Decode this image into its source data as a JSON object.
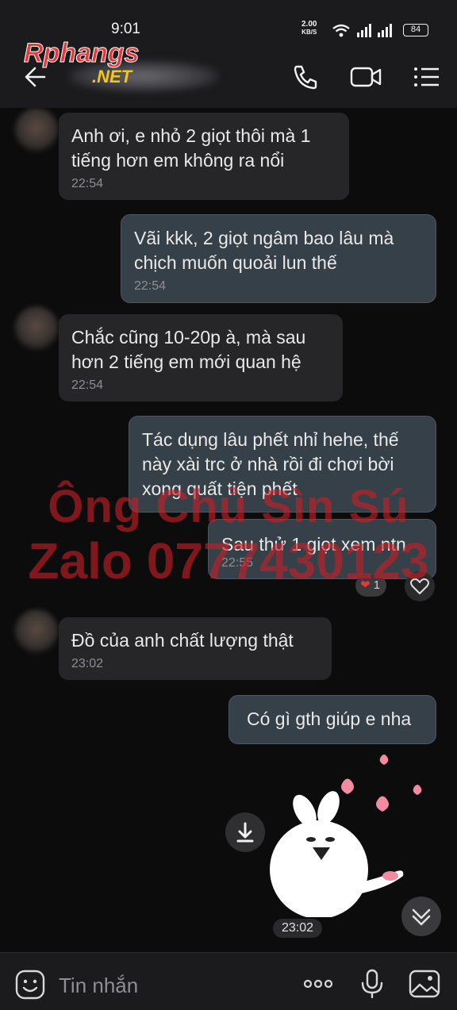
{
  "status_bar": {
    "time": "9:01",
    "speed_value": "2.00",
    "speed_unit": "KB/S",
    "battery": "84"
  },
  "header": {
    "logo_main": "Rphangs",
    "logo_sub": ".NET"
  },
  "messages": [
    {
      "direction": "in",
      "text": "Anh ơi, e nhỏ 2 giọt thôi mà 1 tiếng hơn em không ra nổi",
      "time": "22:54"
    },
    {
      "direction": "out",
      "text": "Vãi kkk, 2 giọt ngâm bao lâu mà chịch muốn quoải lun thế",
      "time": "22:54"
    },
    {
      "direction": "in",
      "text": "Chắc cũng 10-20p à, mà sau hơn 2 tiếng em mới quan hệ",
      "time": "22:54"
    },
    {
      "direction": "out",
      "text": "Tác dụng lâu phết nhỉ hehe, thế này xài trc ở nhà rồi đi chơi bời xong quất tiện phết",
      "time": ""
    },
    {
      "direction": "out",
      "text": "Sau thử 1 giọt xem ntn",
      "time": "22:55",
      "reaction_count": "1"
    },
    {
      "direction": "in",
      "text": "Đồ của anh chất lượng thật",
      "time": "23:02"
    },
    {
      "direction": "out",
      "text": "Có gì gth giúp e nha",
      "time": ""
    }
  ],
  "sticker": {
    "time": "23:02"
  },
  "watermark": {
    "line1": "Ông Chủ Sìn Sú",
    "line2": "Zalo 0777430123"
  },
  "input": {
    "placeholder": "Tin nhắn"
  },
  "colors": {
    "incoming_bubble": "#262628",
    "outgoing_bubble": "#364048",
    "watermark": "#c81e28",
    "background": "#0c0c0d"
  }
}
